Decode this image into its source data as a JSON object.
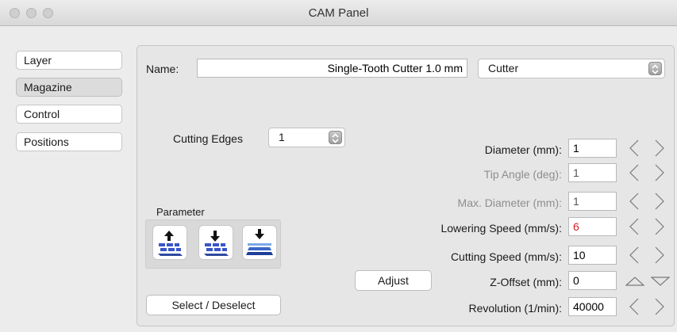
{
  "window": {
    "title": "CAM Panel"
  },
  "sidebar": {
    "items": [
      {
        "label": "Layer"
      },
      {
        "label": "Magazine"
      },
      {
        "label": "Control"
      },
      {
        "label": "Positions"
      }
    ]
  },
  "tool": {
    "name_label": "Name:",
    "name_value": "Single-Tooth Cutter 1.0 mm",
    "type_value": "Cutter"
  },
  "cutting_edges": {
    "label": "Cutting Edges",
    "value": "1"
  },
  "parameter": {
    "label": "Parameter",
    "icons": [
      "parameter-upload-icon",
      "parameter-download-icon",
      "parameter-layer-icon"
    ]
  },
  "fields": [
    {
      "label": "Diameter (mm):",
      "value": "1"
    },
    {
      "label": "Tip Angle (deg):",
      "value": "1"
    },
    {
      "label": "Max. Diameter (mm):",
      "value": "1"
    },
    {
      "label": "Lowering Speed (mm/s):",
      "value": "6"
    },
    {
      "label": "Cutting Speed (mm/s):",
      "value": "10"
    },
    {
      "label": "Z-Offset (mm):",
      "value": "0"
    },
    {
      "label": "Revolution (1/min):",
      "value": "40000"
    }
  ],
  "buttons": {
    "adjust": "Adjust",
    "select_deselect": "Select / Deselect"
  },
  "colors": {
    "warning_value": "#d41f1f",
    "disabled_label": "#8e8e8e"
  }
}
